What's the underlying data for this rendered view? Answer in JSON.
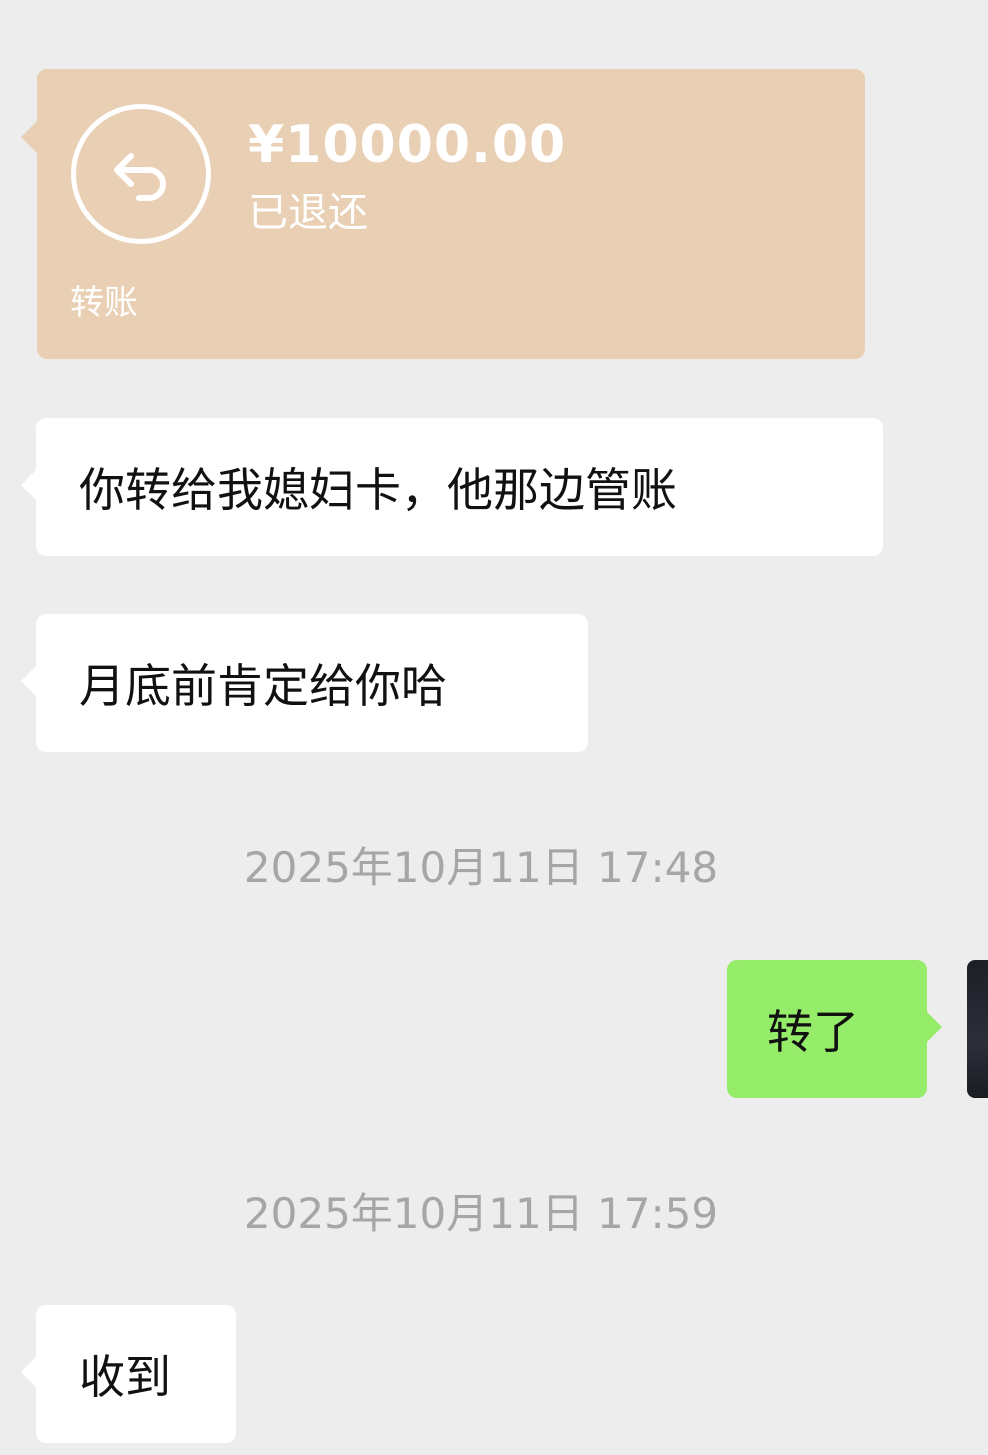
{
  "transfer": {
    "amount": "¥10000.00",
    "status": "已退还",
    "label": "转账",
    "icon": "refund-return-icon",
    "color": "#e9cfb3"
  },
  "messages": [
    {
      "side": "left",
      "text": "你转给我媳妇卡，他那边管账"
    },
    {
      "side": "left",
      "text": "月底前肯定给你哈"
    },
    {
      "side": "right",
      "text": "转了"
    },
    {
      "side": "left",
      "text": "收到"
    }
  ],
  "timestamps": [
    "2025年10月11日 17:48",
    "2025年10月11日 17:59"
  ],
  "colors": {
    "background": "#ededed",
    "incoming_bubble": "#ffffff",
    "outgoing_bubble": "#95ec69",
    "timestamp_text": "#a6a6a6"
  }
}
